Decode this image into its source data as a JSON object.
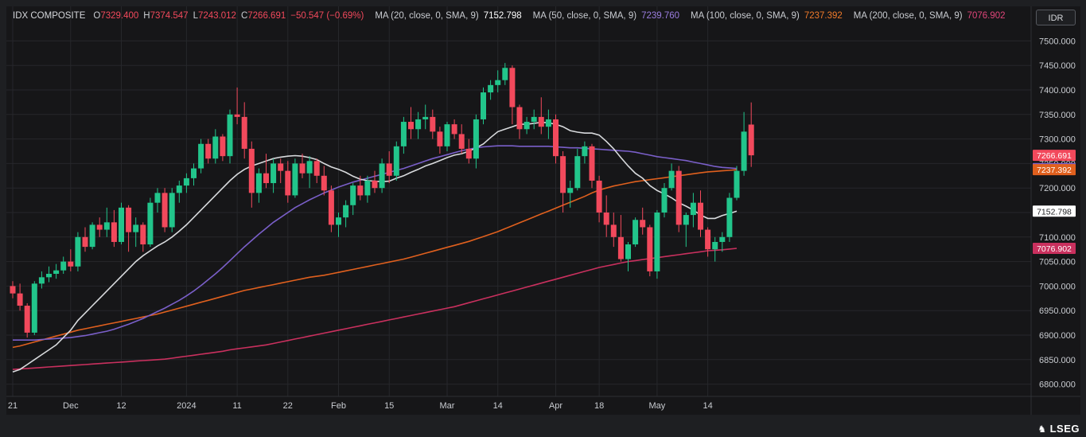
{
  "legend": {
    "symbol": "IDX COMPOSITE",
    "open_label": "O",
    "open": "7329.400",
    "high_label": "H",
    "high": "7374.547",
    "low_label": "L",
    "low": "7243.012",
    "close_label": "C",
    "close": "7266.691",
    "change": "−50.547 (−0.69%)",
    "ma20_label": "MA (20, close, 0, SMA, 9)",
    "ma20_value": "7152.798",
    "ma50_label": "MA (50, close, 0, SMA, 9)",
    "ma50_value": "7239.760",
    "ma100_label": "MA (100, close, 0, SMA, 9)",
    "ma100_value": "7237.392",
    "ma200_label": "MA (200, close, 0, SMA, 9)",
    "ma200_value": "7076.902"
  },
  "currency": "IDR",
  "brand": "LSEG",
  "brand_icon": "lseg-stallion-icon",
  "colors": {
    "up": "#22c58b",
    "down": "#f2495c",
    "ma20": "#d8dadd",
    "ma50": "#7a5fc9",
    "ma100": "#e0601e",
    "ma200": "#c9305e",
    "grid": "#26272b",
    "axis_text": "#c9ccd1"
  },
  "chart_data": {
    "type": "candlestick",
    "y_axis_ticks": [
      6800,
      6850,
      6900,
      6950,
      7000,
      7050,
      7100,
      7150,
      7200,
      7250,
      7300,
      7350,
      7400,
      7450,
      7500
    ],
    "tick_format_decimals": 3,
    "ylim": [
      6775,
      7525
    ],
    "x_tick_labels": [
      "21",
      "Dec",
      "12",
      "2024",
      "11",
      "22",
      "Feb",
      "15",
      "Mar",
      "14",
      "Apr",
      "18",
      "May",
      "14"
    ],
    "x_tick_index": [
      0,
      8,
      15,
      24,
      31,
      38,
      45,
      52,
      60,
      67,
      75,
      81,
      89,
      96
    ],
    "grid": true,
    "price_labels": [
      {
        "value": 7266.691,
        "text": "7266.691",
        "bg": "#f2495c",
        "fg": "#ffffff"
      },
      {
        "value": 7239.76,
        "text": "7239.760",
        "bg": "#7a5fc9",
        "fg": "#ffffff"
      },
      {
        "value": 7237.392,
        "text": "7237.392",
        "bg": "#e0601e",
        "fg": "#ffffff"
      },
      {
        "value": 7152.798,
        "text": "7152.798",
        "bg": "#ffffff",
        "fg": "#1e1f22"
      },
      {
        "value": 7076.902,
        "text": "7076.902",
        "bg": "#c9305e",
        "fg": "#ffffff"
      }
    ],
    "ohlc": [
      [
        7000,
        7010,
        6975,
        6985
      ],
      [
        6985,
        7005,
        6950,
        6960
      ],
      [
        6960,
        6965,
        6895,
        6905
      ],
      [
        6905,
        7010,
        6900,
        7005
      ],
      [
        7005,
        7030,
        6995,
        7018
      ],
      [
        7018,
        7040,
        7008,
        7025
      ],
      [
        7025,
        7045,
        7015,
        7032
      ],
      [
        7032,
        7060,
        7025,
        7050
      ],
      [
        7050,
        7075,
        7030,
        7040
      ],
      [
        7040,
        7110,
        7030,
        7100
      ],
      [
        7100,
        7120,
        7070,
        7080
      ],
      [
        7080,
        7130,
        7075,
        7125
      ],
      [
        7125,
        7140,
        7100,
        7115
      ],
      [
        7115,
        7160,
        7100,
        7130
      ],
      [
        7130,
        7155,
        7080,
        7090
      ],
      [
        7090,
        7170,
        7085,
        7160
      ],
      [
        7160,
        7165,
        7070,
        7110
      ],
      [
        7110,
        7140,
        7080,
        7125
      ],
      [
        7125,
        7130,
        7070,
        7085
      ],
      [
        7085,
        7180,
        7080,
        7170
      ],
      [
        7170,
        7200,
        7150,
        7190
      ],
      [
        7190,
        7200,
        7110,
        7120
      ],
      [
        7120,
        7200,
        7110,
        7190
      ],
      [
        7190,
        7215,
        7170,
        7205
      ],
      [
        7205,
        7230,
        7190,
        7220
      ],
      [
        7220,
        7250,
        7205,
        7240
      ],
      [
        7240,
        7300,
        7230,
        7290
      ],
      [
        7290,
        7300,
        7250,
        7260
      ],
      [
        7260,
        7320,
        7250,
        7305
      ],
      [
        7305,
        7310,
        7255,
        7265
      ],
      [
        7265,
        7360,
        7250,
        7350
      ],
      [
        7350,
        7405,
        7330,
        7345
      ],
      [
        7345,
        7375,
        7260,
        7280
      ],
      [
        7280,
        7295,
        7160,
        7190
      ],
      [
        7190,
        7240,
        7170,
        7230
      ],
      [
        7230,
        7270,
        7200,
        7210
      ],
      [
        7210,
        7260,
        7190,
        7250
      ],
      [
        7250,
        7260,
        7210,
        7235
      ],
      [
        7235,
        7255,
        7170,
        7185
      ],
      [
        7185,
        7260,
        7180,
        7250
      ],
      [
        7250,
        7270,
        7220,
        7230
      ],
      [
        7230,
        7265,
        7200,
        7255
      ],
      [
        7255,
        7260,
        7210,
        7225
      ],
      [
        7225,
        7245,
        7185,
        7195
      ],
      [
        7195,
        7205,
        7110,
        7125
      ],
      [
        7125,
        7150,
        7100,
        7140
      ],
      [
        7140,
        7175,
        7120,
        7165
      ],
      [
        7165,
        7210,
        7145,
        7205
      ],
      [
        7205,
        7225,
        7175,
        7185
      ],
      [
        7185,
        7225,
        7170,
        7215
      ],
      [
        7215,
        7235,
        7190,
        7200
      ],
      [
        7200,
        7260,
        7190,
        7250
      ],
      [
        7250,
        7275,
        7210,
        7225
      ],
      [
        7225,
        7295,
        7215,
        7285
      ],
      [
        7285,
        7345,
        7270,
        7335
      ],
      [
        7335,
        7365,
        7300,
        7320
      ],
      [
        7320,
        7355,
        7300,
        7340
      ],
      [
        7340,
        7370,
        7320,
        7345
      ],
      [
        7345,
        7360,
        7300,
        7315
      ],
      [
        7315,
        7325,
        7270,
        7285
      ],
      [
        7285,
        7335,
        7275,
        7330
      ],
      [
        7330,
        7340,
        7300,
        7310
      ],
      [
        7310,
        7330,
        7270,
        7280
      ],
      [
        7280,
        7300,
        7250,
        7260
      ],
      [
        7260,
        7350,
        7240,
        7340
      ],
      [
        7340,
        7405,
        7330,
        7395
      ],
      [
        7395,
        7420,
        7380,
        7410
      ],
      [
        7410,
        7440,
        7395,
        7420
      ],
      [
        7420,
        7455,
        7410,
        7445
      ],
      [
        7445,
        7450,
        7330,
        7365
      ],
      [
        7365,
        7370,
        7300,
        7320
      ],
      [
        7320,
        7345,
        7310,
        7335
      ],
      [
        7335,
        7360,
        7320,
        7345
      ],
      [
        7345,
        7385,
        7310,
        7325
      ],
      [
        7325,
        7360,
        7300,
        7340
      ],
      [
        7340,
        7350,
        7250,
        7265
      ],
      [
        7265,
        7275,
        7150,
        7190
      ],
      [
        7190,
        7215,
        7160,
        7200
      ],
      [
        7200,
        7280,
        7195,
        7265
      ],
      [
        7265,
        7295,
        7250,
        7285
      ],
      [
        7285,
        7290,
        7200,
        7215
      ],
      [
        7215,
        7225,
        7130,
        7150
      ],
      [
        7150,
        7185,
        7100,
        7125
      ],
      [
        7125,
        7150,
        7080,
        7100
      ],
      [
        7100,
        7145,
        7050,
        7055
      ],
      [
        7055,
        7090,
        7030,
        7085
      ],
      [
        7085,
        7140,
        7080,
        7135
      ],
      [
        7135,
        7160,
        7105,
        7120
      ],
      [
        7120,
        7125,
        7020,
        7030
      ],
      [
        7030,
        7155,
        7015,
        7150
      ],
      [
        7150,
        7210,
        7140,
        7200
      ],
      [
        7200,
        7250,
        7195,
        7235
      ],
      [
        7235,
        7245,
        7110,
        7125
      ],
      [
        7125,
        7150,
        7080,
        7145
      ],
      [
        7145,
        7190,
        7120,
        7170
      ],
      [
        7170,
        7195,
        7100,
        7115
      ],
      [
        7115,
        7120,
        7060,
        7075
      ],
      [
        7075,
        7100,
        7050,
        7090
      ],
      [
        7090,
        7110,
        7070,
        7100
      ],
      [
        7100,
        7190,
        7090,
        7180
      ],
      [
        7180,
        7245,
        7175,
        7235
      ],
      [
        7235,
        7355,
        7225,
        7315
      ],
      [
        7329.4,
        7374.547,
        7243.012,
        7266.691
      ]
    ],
    "ma20": [
      6825,
      6830,
      6840,
      6850,
      6860,
      6870,
      6880,
      6895,
      6910,
      6930,
      6945,
      6960,
      6975,
      6990,
      7005,
      7020,
      7035,
      7050,
      7062,
      7072,
      7082,
      7090,
      7100,
      7112,
      7125,
      7140,
      7155,
      7170,
      7185,
      7200,
      7215,
      7228,
      7238,
      7245,
      7250,
      7255,
      7260,
      7263,
      7265,
      7266,
      7265,
      7262,
      7258,
      7250,
      7243,
      7238,
      7232,
      7224,
      7218,
      7215,
      7214,
      7213,
      7214,
      7220,
      7225,
      7232,
      7238,
      7245,
      7250,
      7256,
      7262,
      7267,
      7270,
      7275,
      7282,
      7290,
      7303,
      7315,
      7320,
      7325,
      7330,
      7330,
      7332,
      7334,
      7333,
      7330,
      7325,
      7317,
      7314,
      7312,
      7312,
      7308,
      7295,
      7280,
      7262,
      7245,
      7230,
      7220,
      7205,
      7195,
      7188,
      7180,
      7170,
      7163,
      7155,
      7145,
      7138,
      7138,
      7144,
      7148,
      7152.8
    ],
    "ma50": [
      6890,
      6890,
      6890,
      6890,
      6891,
      6892,
      6893,
      6894,
      6895,
      6897,
      6899,
      6902,
      6905,
      6908,
      6912,
      6917,
      6922,
      6928,
      6934,
      6941,
      6948,
      6955,
      6963,
      6971,
      6980,
      6990,
      7001,
      7013,
      7025,
      7038,
      7052,
      7066,
      7080,
      7093,
      7106,
      7118,
      7130,
      7140,
      7150,
      7160,
      7168,
      7176,
      7183,
      7190,
      7196,
      7202,
      7207,
      7212,
      7216,
      7220,
      7224,
      7228,
      7232,
      7236,
      7240,
      7245,
      7250,
      7255,
      7260,
      7264,
      7268,
      7272,
      7276,
      7279,
      7282,
      7284,
      7285,
      7286,
      7286,
      7286,
      7285,
      7285,
      7285,
      7285,
      7285,
      7284,
      7283,
      7282,
      7282,
      7281,
      7280,
      7279,
      7278,
      7277,
      7276,
      7275,
      7273,
      7270,
      7267,
      7264,
      7262,
      7260,
      7258,
      7256,
      7253,
      7250,
      7247,
      7244,
      7242,
      7241,
      7239.76
    ],
    "ma100": [
      6875,
      6878,
      6882,
      6886,
      6890,
      6894,
      6898,
      6902,
      6906,
      6910,
      6913,
      6916,
      6919,
      6922,
      6925,
      6928,
      6931,
      6934,
      6937,
      6940,
      6943,
      6947,
      6951,
      6955,
      6959,
      6963,
      6967,
      6971,
      6975,
      6979,
      6983,
      6987,
      6991,
      6994,
      6997,
      7000,
      7003,
      7006,
      7009,
      7012,
      7015,
      7018,
      7020,
      7022,
      7025,
      7028,
      7031,
      7034,
      7037,
      7040,
      7043,
      7046,
      7049,
      7052,
      7055,
      7059,
      7063,
      7067,
      7071,
      7075,
      7079,
      7083,
      7087,
      7091,
      7096,
      7101,
      7106,
      7111,
      7117,
      7123,
      7129,
      7135,
      7141,
      7147,
      7153,
      7159,
      7165,
      7171,
      7177,
      7183,
      7190,
      7196,
      7200,
      7204,
      7207,
      7210,
      7213,
      7215,
      7217,
      7219,
      7221,
      7223,
      7225,
      7227,
      7229,
      7231,
      7233,
      7234,
      7235,
      7236,
      7237.392
    ],
    "ma200": [
      6830,
      6831,
      6832,
      6833,
      6834,
      6835,
      6836,
      6837,
      6838,
      6839,
      6840,
      6841,
      6842,
      6843,
      6844,
      6845,
      6846,
      6847,
      6848,
      6849,
      6850,
      6851,
      6853,
      6855,
      6857,
      6859,
      6861,
      6863,
      6865,
      6867,
      6870,
      6872,
      6874,
      6876,
      6878,
      6880,
      6883,
      6886,
      6889,
      6892,
      6895,
      6898,
      6901,
      6904,
      6907,
      6910,
      6913,
      6916,
      6919,
      6922,
      6925,
      6928,
      6931,
      6934,
      6937,
      6940,
      6943,
      6946,
      6949,
      6952,
      6955,
      6958,
      6962,
      6966,
      6970,
      6974,
      6978,
      6982,
      6986,
      6990,
      6994,
      6998,
      7002,
      7006,
      7010,
      7014,
      7018,
      7022,
      7026,
      7030,
      7034,
      7038,
      7041,
      7044,
      7047,
      7050,
      7052,
      7054,
      7056,
      7058,
      7060,
      7062,
      7064,
      7066,
      7068,
      7070,
      7072,
      7073,
      7074,
      7075.5,
      7076.902
    ]
  }
}
